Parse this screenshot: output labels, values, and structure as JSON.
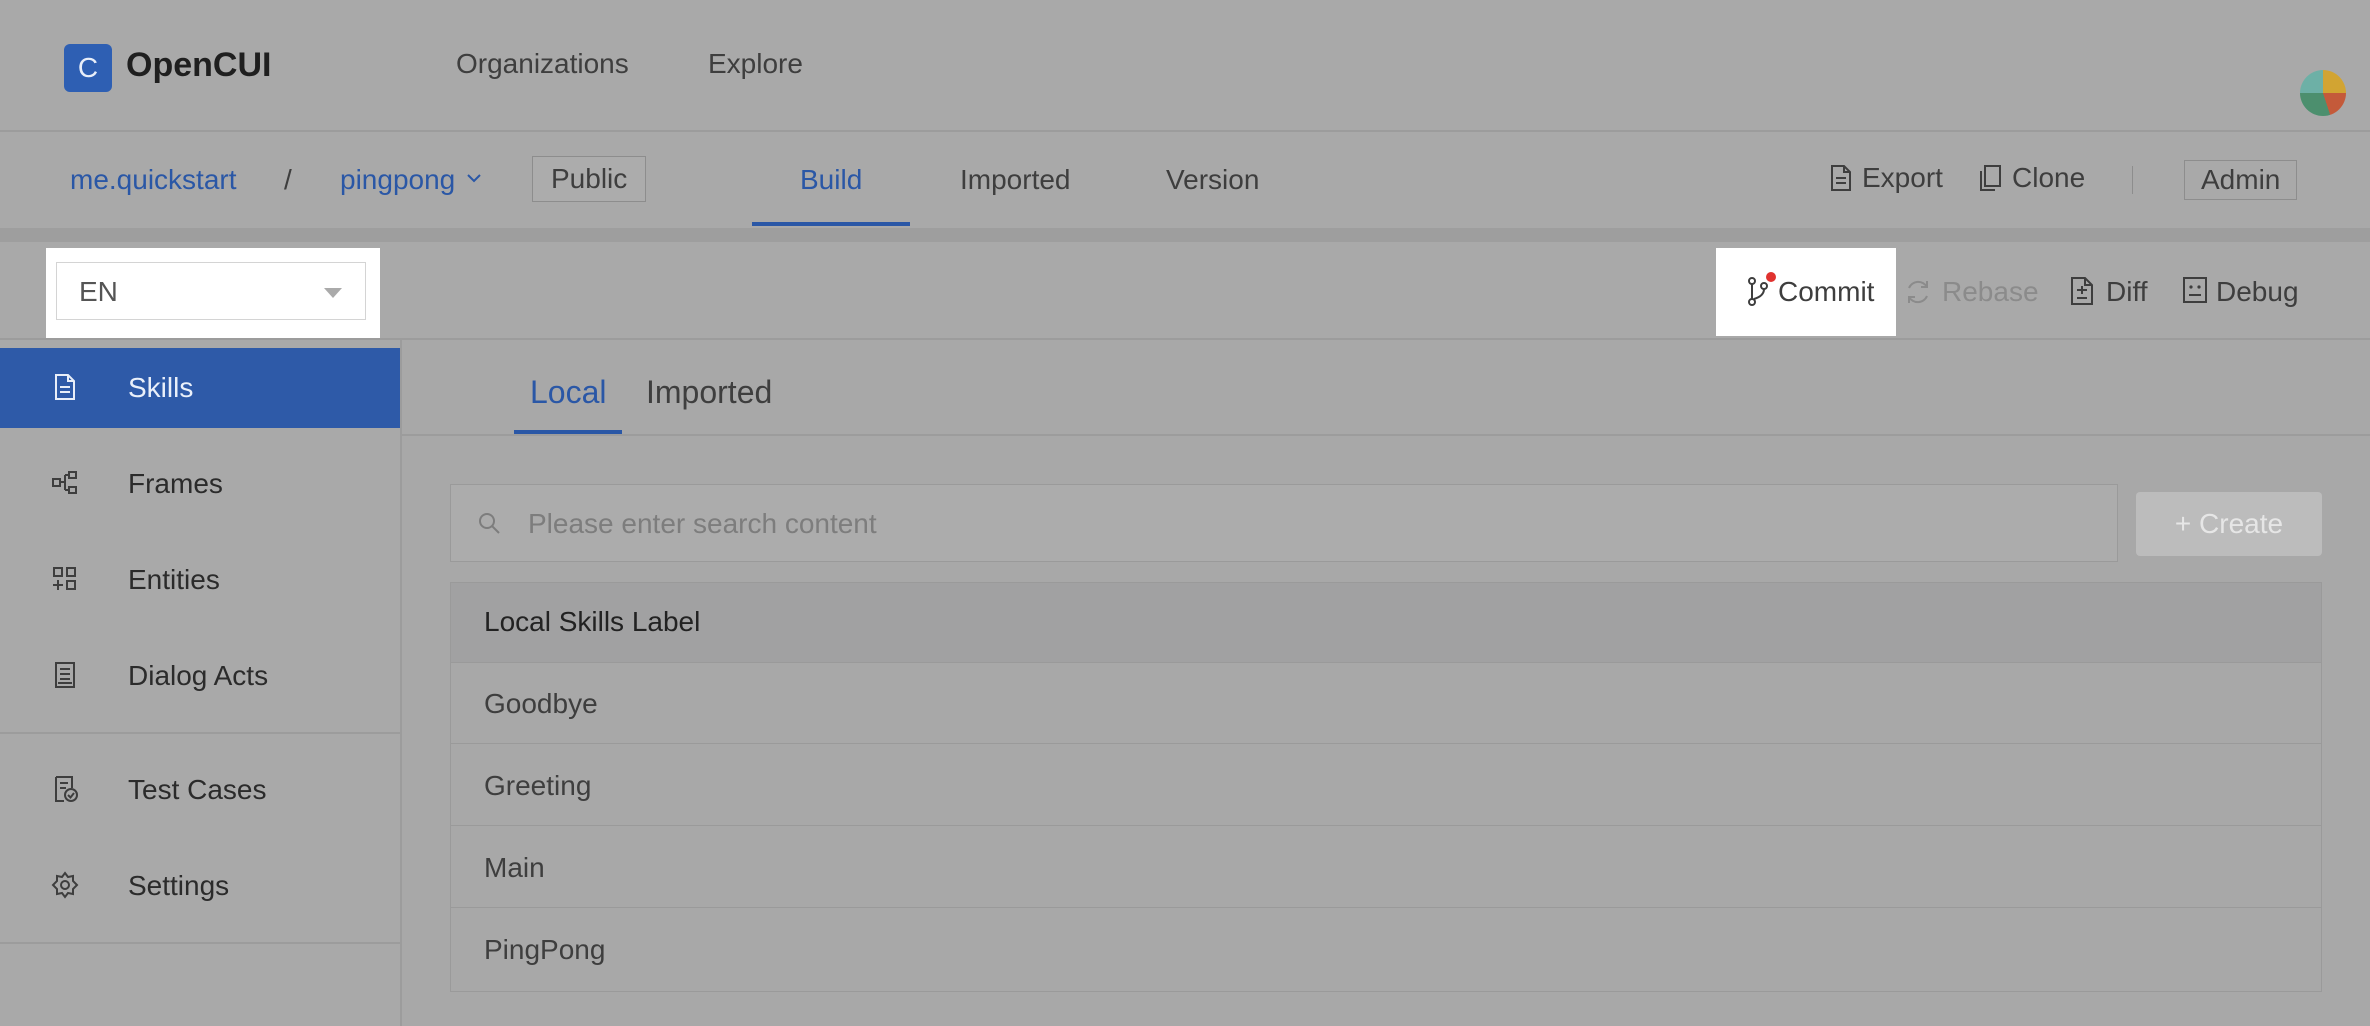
{
  "app": {
    "logo_glyph": "C",
    "name": "OpenCUI"
  },
  "top_nav": {
    "links": [
      "Organizations",
      "Explore"
    ]
  },
  "breadcrumb": {
    "org": "me.quickstart",
    "separator": "/",
    "project": "pingpong",
    "visibility": "Public"
  },
  "project_tabs": [
    {
      "label": "Build",
      "active": true
    },
    {
      "label": "Imported",
      "active": false
    },
    {
      "label": "Version",
      "active": false
    }
  ],
  "project_actions": {
    "export": "Export",
    "clone": "Clone",
    "admin": "Admin"
  },
  "toolbar": {
    "language": "EN",
    "commit": "Commit",
    "rebase": "Rebase",
    "diff": "Diff",
    "debug": "Debug"
  },
  "sidebar": {
    "items": [
      {
        "label": "Skills",
        "icon": "document-icon",
        "active": true
      },
      {
        "label": "Frames",
        "icon": "frames-icon",
        "active": false
      },
      {
        "label": "Entities",
        "icon": "entities-icon",
        "active": false
      },
      {
        "label": "Dialog Acts",
        "icon": "dialog-acts-icon",
        "active": false
      },
      {
        "label": "Test Cases",
        "icon": "test-cases-icon",
        "active": false
      },
      {
        "label": "Settings",
        "icon": "gear-icon",
        "active": false
      }
    ]
  },
  "main": {
    "tabs": [
      {
        "label": "Local",
        "active": true
      },
      {
        "label": "Imported",
        "active": false
      }
    ],
    "search": {
      "placeholder": "Please enter search content"
    },
    "create_label": "Create",
    "table": {
      "header": "Local Skills Label",
      "rows": [
        "Goodbye",
        "Greeting",
        "Main",
        "PingPong"
      ]
    }
  },
  "colors": {
    "accent": "#2e5aa8",
    "overlay": "#a9a9a9",
    "dot": "#e0322f"
  }
}
